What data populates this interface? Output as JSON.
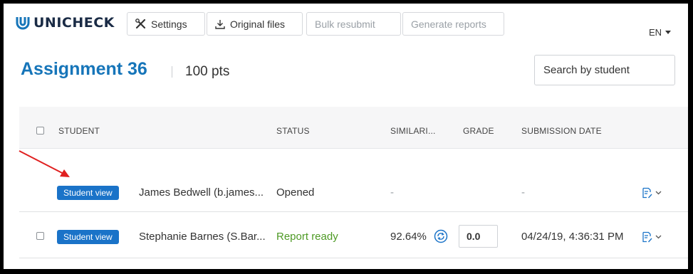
{
  "app": {
    "logo_text": "UNICHECK"
  },
  "toolbar": {
    "settings_label": "Settings",
    "original_files_label": "Original files",
    "bulk_resubmit_label": "Bulk resubmit",
    "generate_reports_label": "Generate reports",
    "language": "EN"
  },
  "assignment": {
    "title": "Assignment 36",
    "points": "100 pts",
    "search_placeholder": "Search by student"
  },
  "table": {
    "headers": {
      "student": "STUDENT",
      "status": "STATUS",
      "similarity": "SIMILARI...",
      "grade": "GRADE",
      "submission_date": "SUBMISSION DATE"
    },
    "rows": [
      {
        "button": "Student view",
        "student": "James Bedwell (b.james...",
        "status": "Opened",
        "similarity": "-",
        "grade": "",
        "date": "-"
      },
      {
        "button": "Student view",
        "student": "Stephanie Barnes (S.Bar...",
        "status": "Report ready",
        "similarity": "92.64%",
        "grade": "0.0",
        "date": "04/24/19, 4:36:31 PM"
      }
    ]
  },
  "colors": {
    "accent": "#1675b9",
    "button": "#1a73c8",
    "status_ready": "#4e9a25",
    "annotation_arrow": "#e02020"
  },
  "icons": [
    "unicheck-logo-icon",
    "settings-tools-icon",
    "download-icon",
    "resubmit-icon",
    "document-edit-icon",
    "chevron-down-icon"
  ]
}
